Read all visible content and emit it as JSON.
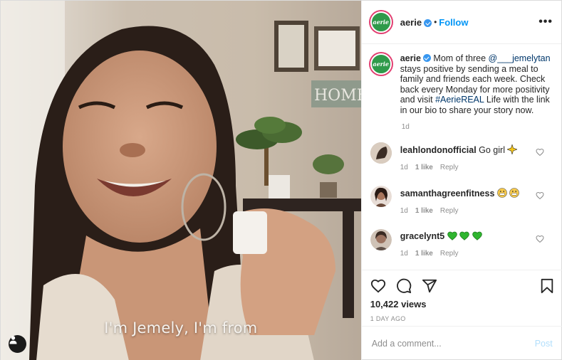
{
  "media": {
    "subtitle": "I'm Jemely, I'm from",
    "wall_sign": "HOME",
    "user_tag_icon": "user-icon"
  },
  "header": {
    "avatar_text": "aerie",
    "username": "aerie",
    "separator": "•",
    "follow_label": "Follow",
    "more_label": "•••"
  },
  "caption": {
    "avatar_text": "aerie",
    "username": "aerie",
    "text_before_mention": "Mom of three ",
    "mention": "@___jemelytan",
    "text_middle": " stays positive by sending a meal to family and friends each week. Check back every Monday for more positivity and visit ",
    "hashtag": "#AerieREAL",
    "text_after": " Life with the link in our bio to share your story now.",
    "time": "1d"
  },
  "comments": [
    {
      "username": "leahlondonofficial",
      "text": "Go girl",
      "emoji": "sparkle",
      "time": "1d",
      "likes": "1 like",
      "reply": "Reply",
      "avatar_color": "#c9b8a8"
    },
    {
      "username": "samanthagreenfitness",
      "text": "",
      "emoji": "grin x2",
      "time": "1d",
      "likes": "1 like",
      "reply": "Reply",
      "avatar_color": "#5a3a2c"
    },
    {
      "username": "gracelynt5",
      "text": "",
      "emoji": "green hearts x3",
      "time": "1d",
      "likes": "1 like",
      "reply": "Reply",
      "avatar_color": "#8c7a6e"
    }
  ],
  "actions": {
    "views": "10,422 views",
    "date": "1 DAY AGO",
    "icons": [
      "heart-icon",
      "comment-icon",
      "share-icon",
      "bookmark-icon"
    ]
  },
  "add_comment": {
    "placeholder": "Add a comment...",
    "post_label": "Post"
  },
  "colors": {
    "brand_green": "#2f9a4a",
    "story_ring": "#e23f71",
    "link_blue": "#0095f6",
    "muted": "#8e8e8e"
  }
}
